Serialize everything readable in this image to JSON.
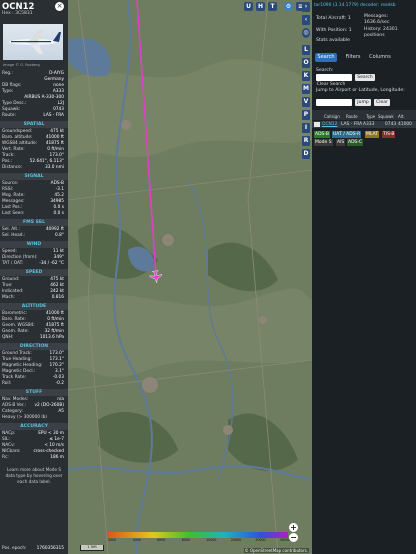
{
  "aircraft": {
    "callsign": "OCN12",
    "hex_label": "Hex : 3C5831",
    "photo_credit": "Image © G. Rozberg",
    "rows": [
      {
        "k": "Reg.:",
        "v": "D-AIYG"
      },
      {
        "k": "",
        "v": "Germany"
      },
      {
        "k": "DB flags:",
        "v": "none"
      },
      {
        "k": "Type:",
        "v": "A333"
      },
      {
        "k": "",
        "v": "AIRBUS A-330-300"
      },
      {
        "k": "Type Desc.:",
        "v": "L2J"
      },
      {
        "k": "Squawk:",
        "v": "0743"
      },
      {
        "k": "Route:",
        "v": "LAS - FRA"
      }
    ]
  },
  "sections": [
    {
      "title": "SPATIAL",
      "rows": [
        {
          "k": "Groundspeed:",
          "v": "475 kt"
        },
        {
          "k": "Baro. altitude:",
          "v": "41000 ft"
        },
        {
          "k": "WGS84 altitude:",
          "v": "41875 ft"
        },
        {
          "k": "Vert. Rate:",
          "v": "0 ft/min"
        },
        {
          "k": "Track:",
          "v": "173.0°"
        },
        {
          "k": "Pos.:",
          "v": "52.641°, 6.113°"
        },
        {
          "k": "Distance:",
          "v": "33.0 nmi"
        }
      ]
    },
    {
      "title": "SIGNAL",
      "rows": [
        {
          "k": "Source:",
          "v": "ADS-B"
        },
        {
          "k": "RSSI:",
          "v": "-3.1"
        },
        {
          "k": "Msg. Rate:",
          "v": "45.2"
        },
        {
          "k": "Messages:",
          "v": "34985"
        },
        {
          "k": "Last Pos.:",
          "v": "0.0 s"
        },
        {
          "k": "Last Seen:",
          "v": "0.0 s"
        }
      ]
    },
    {
      "title": "FMS SEL",
      "rows": [
        {
          "k": "Sel. Alt.:",
          "v": "40992 ft"
        },
        {
          "k": "Sel. Head.:",
          "v": "0.8°"
        }
      ]
    },
    {
      "title": "WIND",
      "rows": [
        {
          "k": "Speed:",
          "v": "11 kt"
        },
        {
          "k": "Direction (from):",
          "v": "349°"
        },
        {
          "k": "TAT / OAT:",
          "v": "-34 / -62 °C"
        }
      ]
    },
    {
      "title": "SPEED",
      "rows": [
        {
          "k": "Ground:",
          "v": "475 kt"
        },
        {
          "k": "True:",
          "v": "462 kt"
        },
        {
          "k": "Indicated:",
          "v": "242 kt"
        },
        {
          "k": "Mach:",
          "v": "0.816"
        }
      ]
    },
    {
      "title": "ALTITUDE",
      "rows": [
        {
          "k": "Barometric:",
          "v": "41000 ft"
        },
        {
          "k": "Baro. Rate:",
          "v": "0 ft/min"
        },
        {
          "k": "Geom. WGS84:",
          "v": "41875 ft"
        },
        {
          "k": "Geom. Rate:",
          "v": "32 ft/min"
        },
        {
          "k": "QNH:",
          "v": "1013.6 hPa"
        }
      ]
    },
    {
      "title": "DIRECTION",
      "rows": [
        {
          "k": "Ground Track:",
          "v": "173.0°"
        },
        {
          "k": "True Heading:",
          "v": "173.1°"
        },
        {
          "k": "Magnetic Heading:",
          "v": "170.2°"
        },
        {
          "k": "Magnetic Decl.:",
          "v": "3.1°"
        },
        {
          "k": "Track Rate:",
          "v": "-0.03"
        },
        {
          "k": "Roll:",
          "v": "-0.2"
        }
      ]
    },
    {
      "title": "STUFF",
      "rows": [
        {
          "k": "Nav. Modes:",
          "v": "n/a"
        },
        {
          "k": "ADS-B Ver.:",
          "v": "v2 (DO-260B)"
        },
        {
          "k": "Category:",
          "v": "A5"
        },
        {
          "k": "Heavy (> 300000 lb)",
          "v": ""
        }
      ]
    },
    {
      "title": "ACCURACY",
      "rows": [
        {
          "k": "NACp:",
          "v": "EPU < 30 m"
        },
        {
          "k": "SIL:",
          "v": "≤ 1e-7"
        },
        {
          "k": "NACv:",
          "v": "< 10 m/s"
        },
        {
          "k": "NICbaro:",
          "v": "cross-checked"
        },
        {
          "k": "Rc:",
          "v": "186 m"
        }
      ]
    }
  ],
  "footer": {
    "note": "Learn more about Mode S data type by hovering over each data label.",
    "epoch_label": "Pos. epoch:",
    "epoch_value": "1760356315"
  },
  "map": {
    "top_buttons": [
      "U",
      "H",
      "T"
    ],
    "side_buttons": [
      "L",
      "O",
      "K",
      "M",
      "V",
      "P",
      "I",
      "R",
      "D"
    ],
    "zoom_in": "+",
    "zoom_out": "−",
    "scale": "1 NM",
    "attribution": "© OpenStreetMap contributors.",
    "alt_legend": [
      "2000",
      "4000",
      "6000",
      "8000",
      "10000",
      "20000",
      "30000",
      "40000+"
    ]
  },
  "sidebar": {
    "version": "tar1090 (3.14.1779) decoder: readsb",
    "total_label": "Total Aircraft: 1",
    "messages_label": "Messages:",
    "messages_value": "1636.6/sec",
    "position_label": "With Position: 1",
    "history_label": "History: 24301 positions",
    "stats_label": "Stats available",
    "tabs": [
      "Search",
      "Filters",
      "Columns"
    ],
    "search_label": "Search:",
    "search_button": "Search",
    "clear_search": "Clear Search",
    "jump_label": "Jump to Airport or Latitude, Longitude:",
    "jump_button": "Jump",
    "clear_button": "Clear",
    "table_headers": [
      "Callsign",
      "Route",
      "Type",
      "Squawk",
      "Alt."
    ],
    "table_row": [
      "OCN12",
      "LAS - FRA",
      "A333",
      "0743",
      "41000"
    ],
    "legend": [
      "ADS-B",
      "UAT / ADS-R",
      "MLAT",
      "TIS-B",
      "Mode S",
      "AIS",
      "ADS-C"
    ],
    "colors": {
      "adsb": "#2b7a2b",
      "uat": "#2d6f8a",
      "mlat": "#8a7a1d",
      "tisb": "#8a2d2d",
      "modes": "#3a3a3a",
      "ais": "#3a3a3a",
      "adsc": "#2d5a2d"
    }
  }
}
